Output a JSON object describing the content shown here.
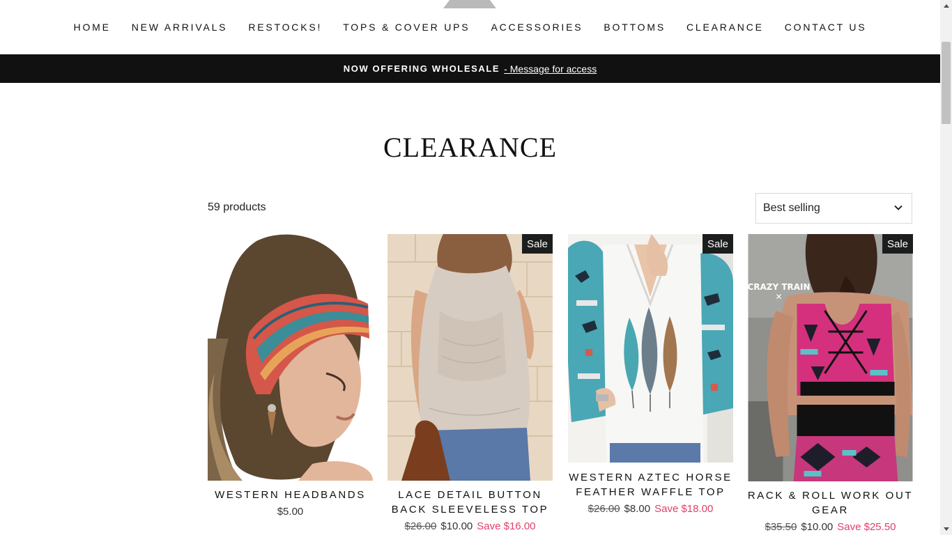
{
  "nav": {
    "items": [
      "HOME",
      "NEW ARRIVALS",
      "RESTOCKS!",
      "TOPS & COVER UPS",
      "ACCESSORIES",
      "BOTTOMS",
      "CLEARANCE",
      "CONTACT US"
    ]
  },
  "announcement": {
    "bold": "NOW OFFERING WHOLESALE",
    "link": "- Message for access"
  },
  "collection": {
    "title": "CLEARANCE",
    "count": "59 products",
    "sort_value": "Best selling"
  },
  "products": [
    {
      "name": "WESTERN HEADBANDS",
      "price": "$5.00",
      "badge": ""
    },
    {
      "name": "LACE DETAIL BUTTON BACK SLEEVELESS TOP",
      "old_price": "$26.00",
      "price": "$10.00",
      "save": "Save $16.00",
      "badge": "Sale"
    },
    {
      "name": "WESTERN AZTEC HORSE FEATHER WAFFLE TOP",
      "old_price": "$26.00",
      "price": "$8.00",
      "save": "Save $18.00",
      "badge": "Sale"
    },
    {
      "name": "RACK & ROLL WORK OUT GEAR",
      "old_price": "$35.50",
      "price": "$10.00",
      "save": "Save $25.50",
      "badge": "Sale",
      "logo_text": "CRAZY TRAIN"
    }
  ],
  "colors": {
    "announcement_bg": "#111111",
    "badge_bg": "#1c1d1d",
    "save_color": "#e0406b"
  }
}
